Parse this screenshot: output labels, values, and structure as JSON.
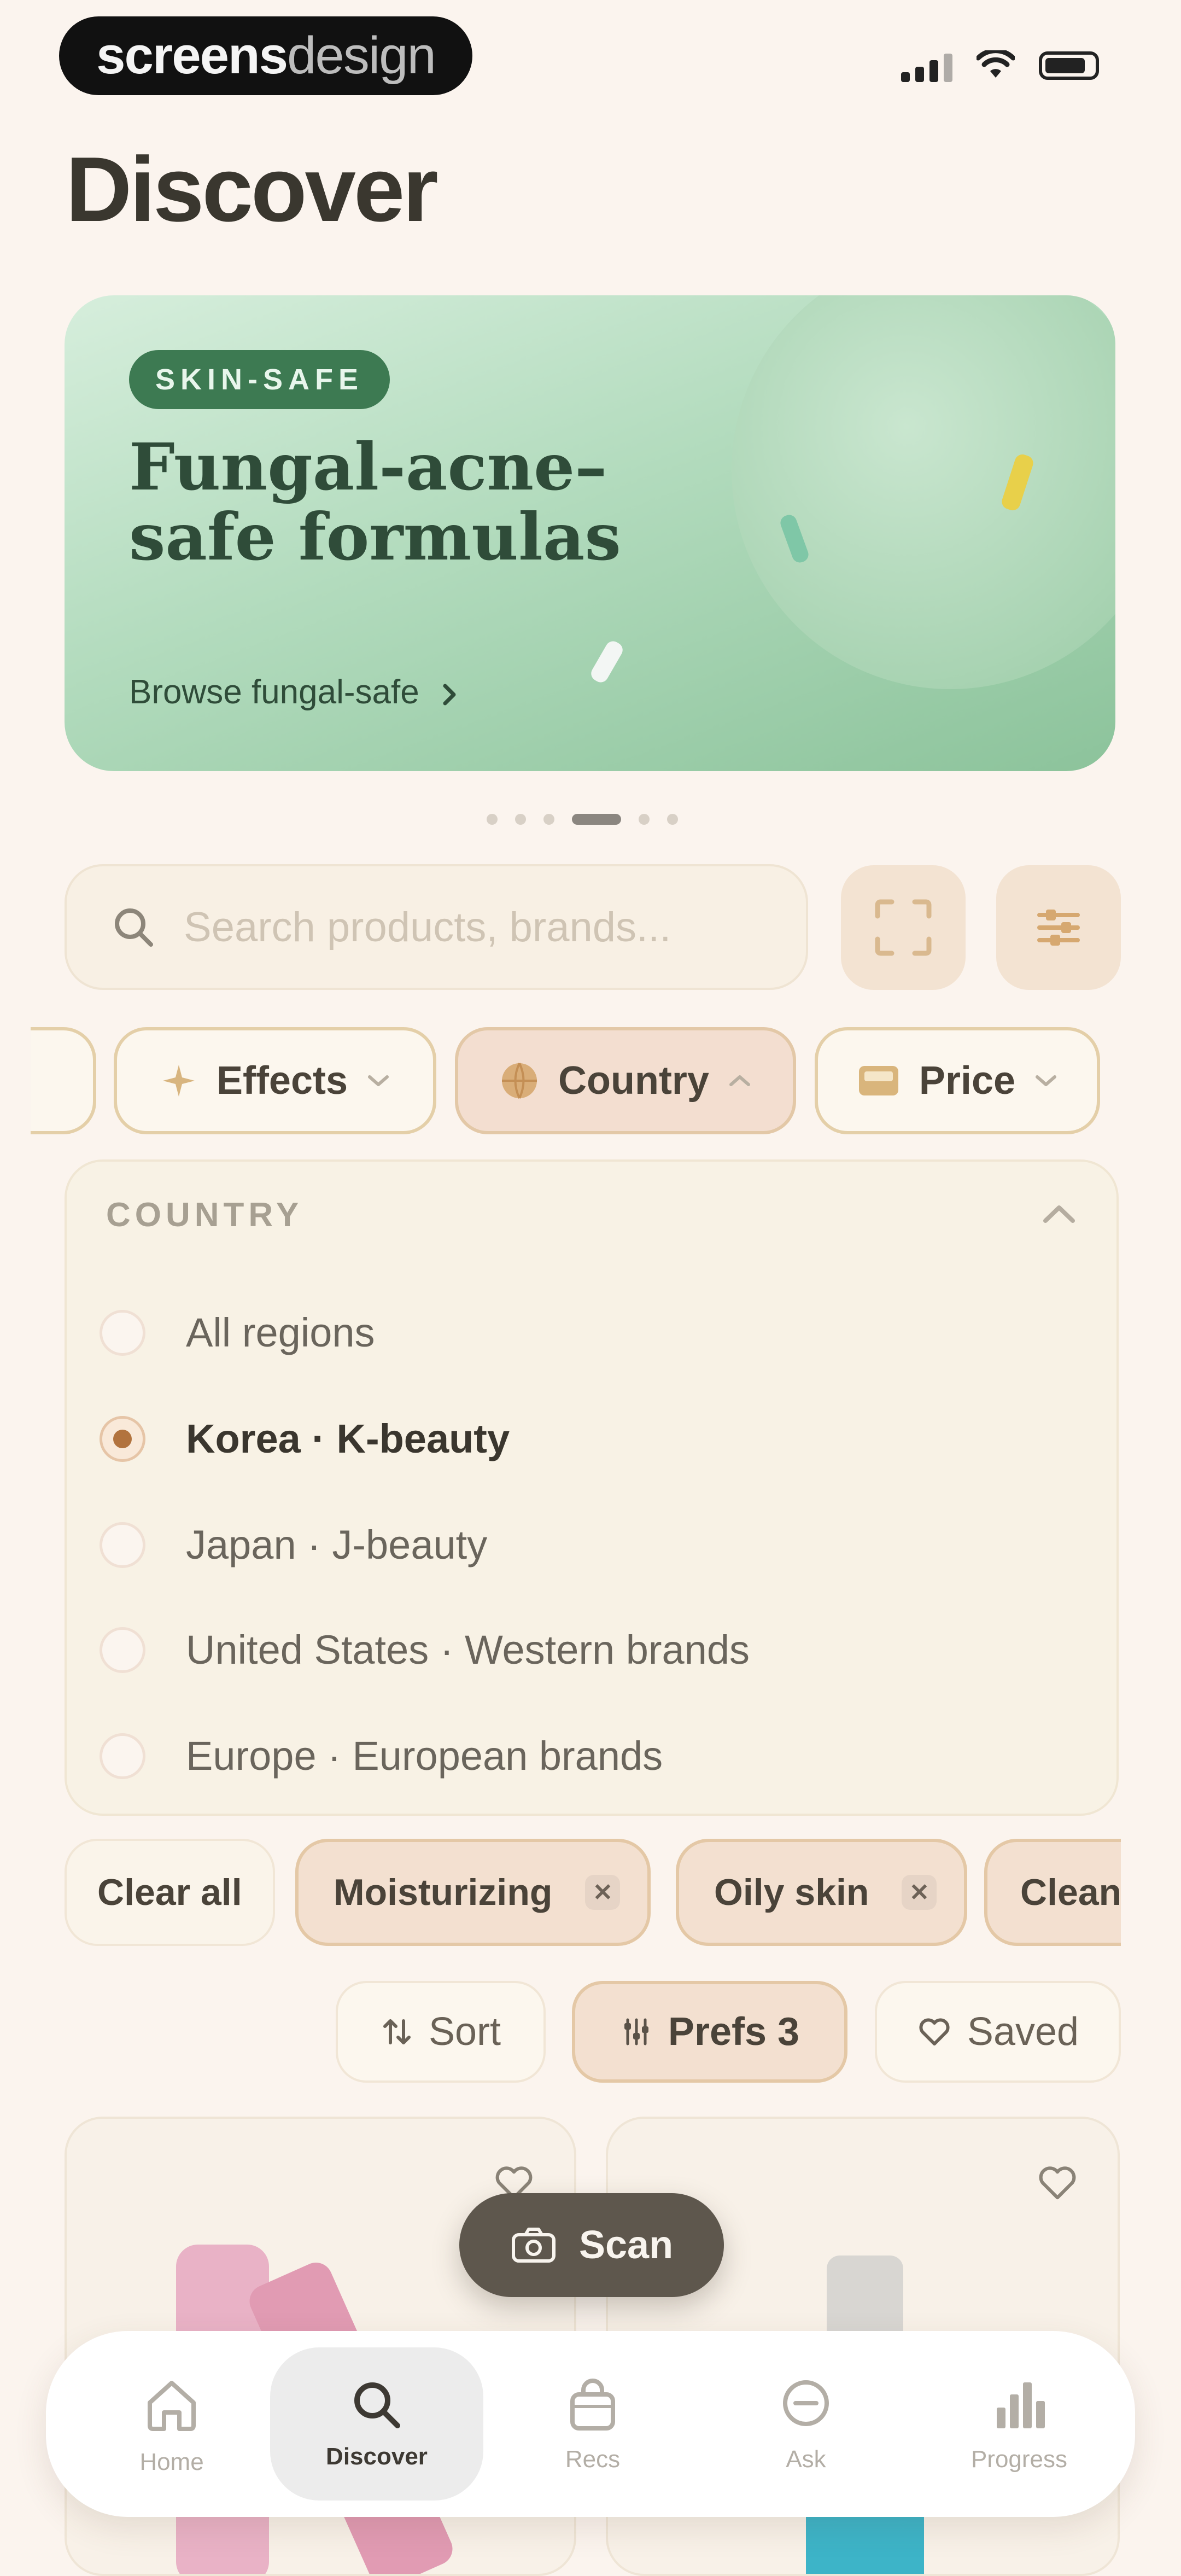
{
  "status_bar": {
    "brand_bold": "screens",
    "brand_light": "design"
  },
  "page": {
    "title": "Discover"
  },
  "hero": {
    "badge": "SKIN-SAFE",
    "headline_line1": "Fungal-acne–",
    "headline_line2": "safe formulas",
    "cta": "Browse fungal-safe",
    "cta_icon": "chevron-right-icon",
    "carousel": {
      "count": 6,
      "active_index": 3
    }
  },
  "search": {
    "placeholder": "Search products, brands...",
    "scan_icon": "scan-frame-icon",
    "filter_icon": "sliders-icon"
  },
  "filters": [
    {
      "label": "Effects",
      "icon": "sparkle-icon",
      "state": "collapsed"
    },
    {
      "label": "Country",
      "icon": "globe-icon",
      "state": "expanded"
    },
    {
      "label": "Price",
      "icon": "wallet-icon",
      "state": "collapsed"
    }
  ],
  "country_panel": {
    "header": "COUNTRY",
    "options": [
      "All regions",
      "Korea · K-beauty",
      "Japan · J-beauty",
      "United States · Western brands",
      "Europe · European brands"
    ],
    "selected": "Korea · K-beauty"
  },
  "active_tags": {
    "clear_label": "Clear all",
    "tags": [
      "Moisturizing",
      "Oily skin",
      "Clean"
    ]
  },
  "toolbar": {
    "sort": "Sort",
    "prefs": "Prefs 3",
    "saved": "Saved"
  },
  "scan_button": {
    "label": "Scan"
  },
  "tabbar": {
    "items": [
      {
        "label": "Home",
        "icon": "home-icon"
      },
      {
        "label": "Discover",
        "icon": "search-icon"
      },
      {
        "label": "Recs",
        "icon": "bag-icon"
      },
      {
        "label": "Ask",
        "icon": "chat-icon"
      },
      {
        "label": "Progress",
        "icon": "bar-chart-icon"
      }
    ],
    "active": "Discover"
  },
  "colors": {
    "background": "#fbf4ee",
    "hero_green": "#8cc39b",
    "accent_brown": "#b2733e",
    "chip_border": "#e4cfa8",
    "fab": "#5e574d"
  }
}
